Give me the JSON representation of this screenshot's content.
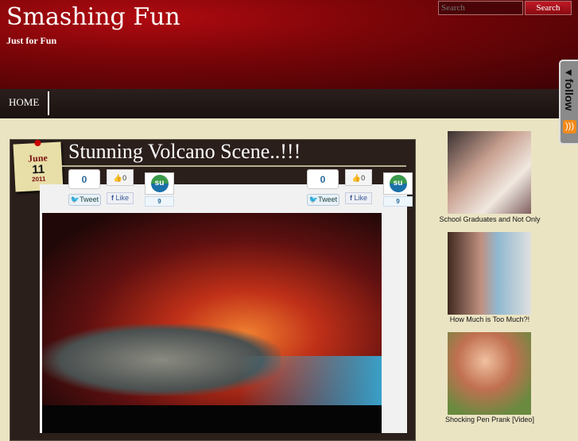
{
  "header": {
    "title": "Smashing Fun",
    "tagline": "Just for Fun",
    "search_placeholder": "Search",
    "search_button": "Search"
  },
  "nav": {
    "home": "HOME"
  },
  "follow": {
    "label": "◂follow"
  },
  "post": {
    "date": {
      "month": "June",
      "day": "11",
      "year": "2011"
    },
    "title": "Stunning Volcano Scene..!!!",
    "share_left": {
      "tweet_count": "0",
      "tweet": "Tweet",
      "like_count": "0",
      "like": "Like",
      "stumble_count": "9"
    },
    "share_right": {
      "tweet_count": "0",
      "tweet": "Tweet",
      "like_count": "0",
      "like": "Like",
      "stumble_count": "9"
    }
  },
  "sidebar": {
    "items": [
      {
        "caption": "School Graduates and Not Only"
      },
      {
        "caption": "How Much is Too Much?!"
      },
      {
        "caption": "Shocking Pen Prank [Video]"
      }
    ]
  }
}
